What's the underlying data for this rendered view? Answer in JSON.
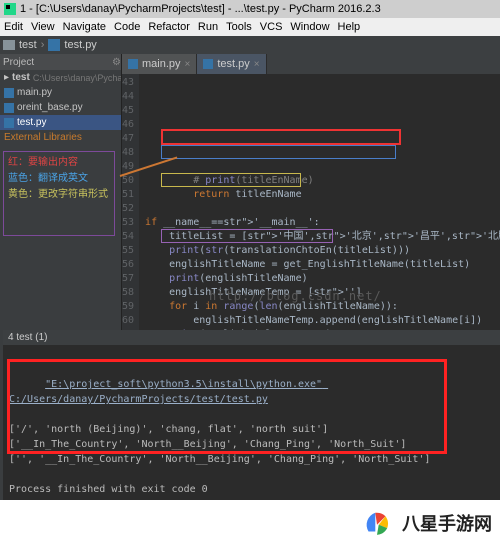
{
  "title_bar": {
    "text": "1 - [C:\\Users\\danay\\PycharmProjects\\test] - ...\\test.py - PyCharm 2016.2.3"
  },
  "menubar": [
    "Edit",
    "View",
    "Navigate",
    "Code",
    "Refactor",
    "Run",
    "Tools",
    "VCS",
    "Window",
    "Help"
  ],
  "breadcrumbs": {
    "root": "test",
    "file": "test.py"
  },
  "project_panel": {
    "header": "Project",
    "items": [
      {
        "label": "test",
        "hint": "C:\\Users\\danay\\PycharmProjects\\test",
        "type": "root"
      },
      {
        "label": "main.py",
        "type": "file"
      },
      {
        "label": "oreint_base.py",
        "type": "file"
      },
      {
        "label": "test.py",
        "type": "file",
        "selected": true
      },
      {
        "label": "External Libraries",
        "type": "lib"
      }
    ]
  },
  "annotation": {
    "red": "红：要输出内容",
    "blue": "蓝色：翻译成英文",
    "yellow": "黄色：更改字符串形式"
  },
  "editor": {
    "tabs": [
      {
        "name": "main.py",
        "active": false
      },
      {
        "name": "test.py",
        "active": true
      }
    ],
    "gutter_start": 43,
    "gutter_end": 60,
    "lines": [
      "        # print(titleEnName)",
      "        return titleEnName",
      "",
      "if __name__=='__main__':",
      "    titleList = ['中国','北京','昌平','北服']",
      "    print(str(translationChtoEn(titleList)))",
      "    englishTitleName = get_EnglishTitleName(titleList)",
      "    print(englishTitleName)",
      "    englishTitleNameTemp = ['']",
      "    for i in range(len(englishTitleName)):",
      "        englishTitleNameTemp.append(englishTitleName[i])",
      "    print(englishTitleNameTemp)"
    ],
    "watermark": "http://blog.csdn.net/"
  },
  "run": {
    "tab": "4 test (1)",
    "cmd": "\"E:\\project_soft\\python3.5\\install\\python.exe\" C:/Users/danay/PycharmProjects/test/test.py",
    "out_lines": [
      "['/', 'north (Beijing)', 'chang, flat', 'north suit']",
      "['__In_The_Country', 'North__Beijing', 'Chang_Ping', 'North_Suit']",
      "['', '__In_The_Country', 'North__Beijing', 'Chang_Ping', 'North_Suit']",
      "",
      "Process finished with exit code 0"
    ]
  },
  "footer": {
    "site": "八星手游网"
  }
}
